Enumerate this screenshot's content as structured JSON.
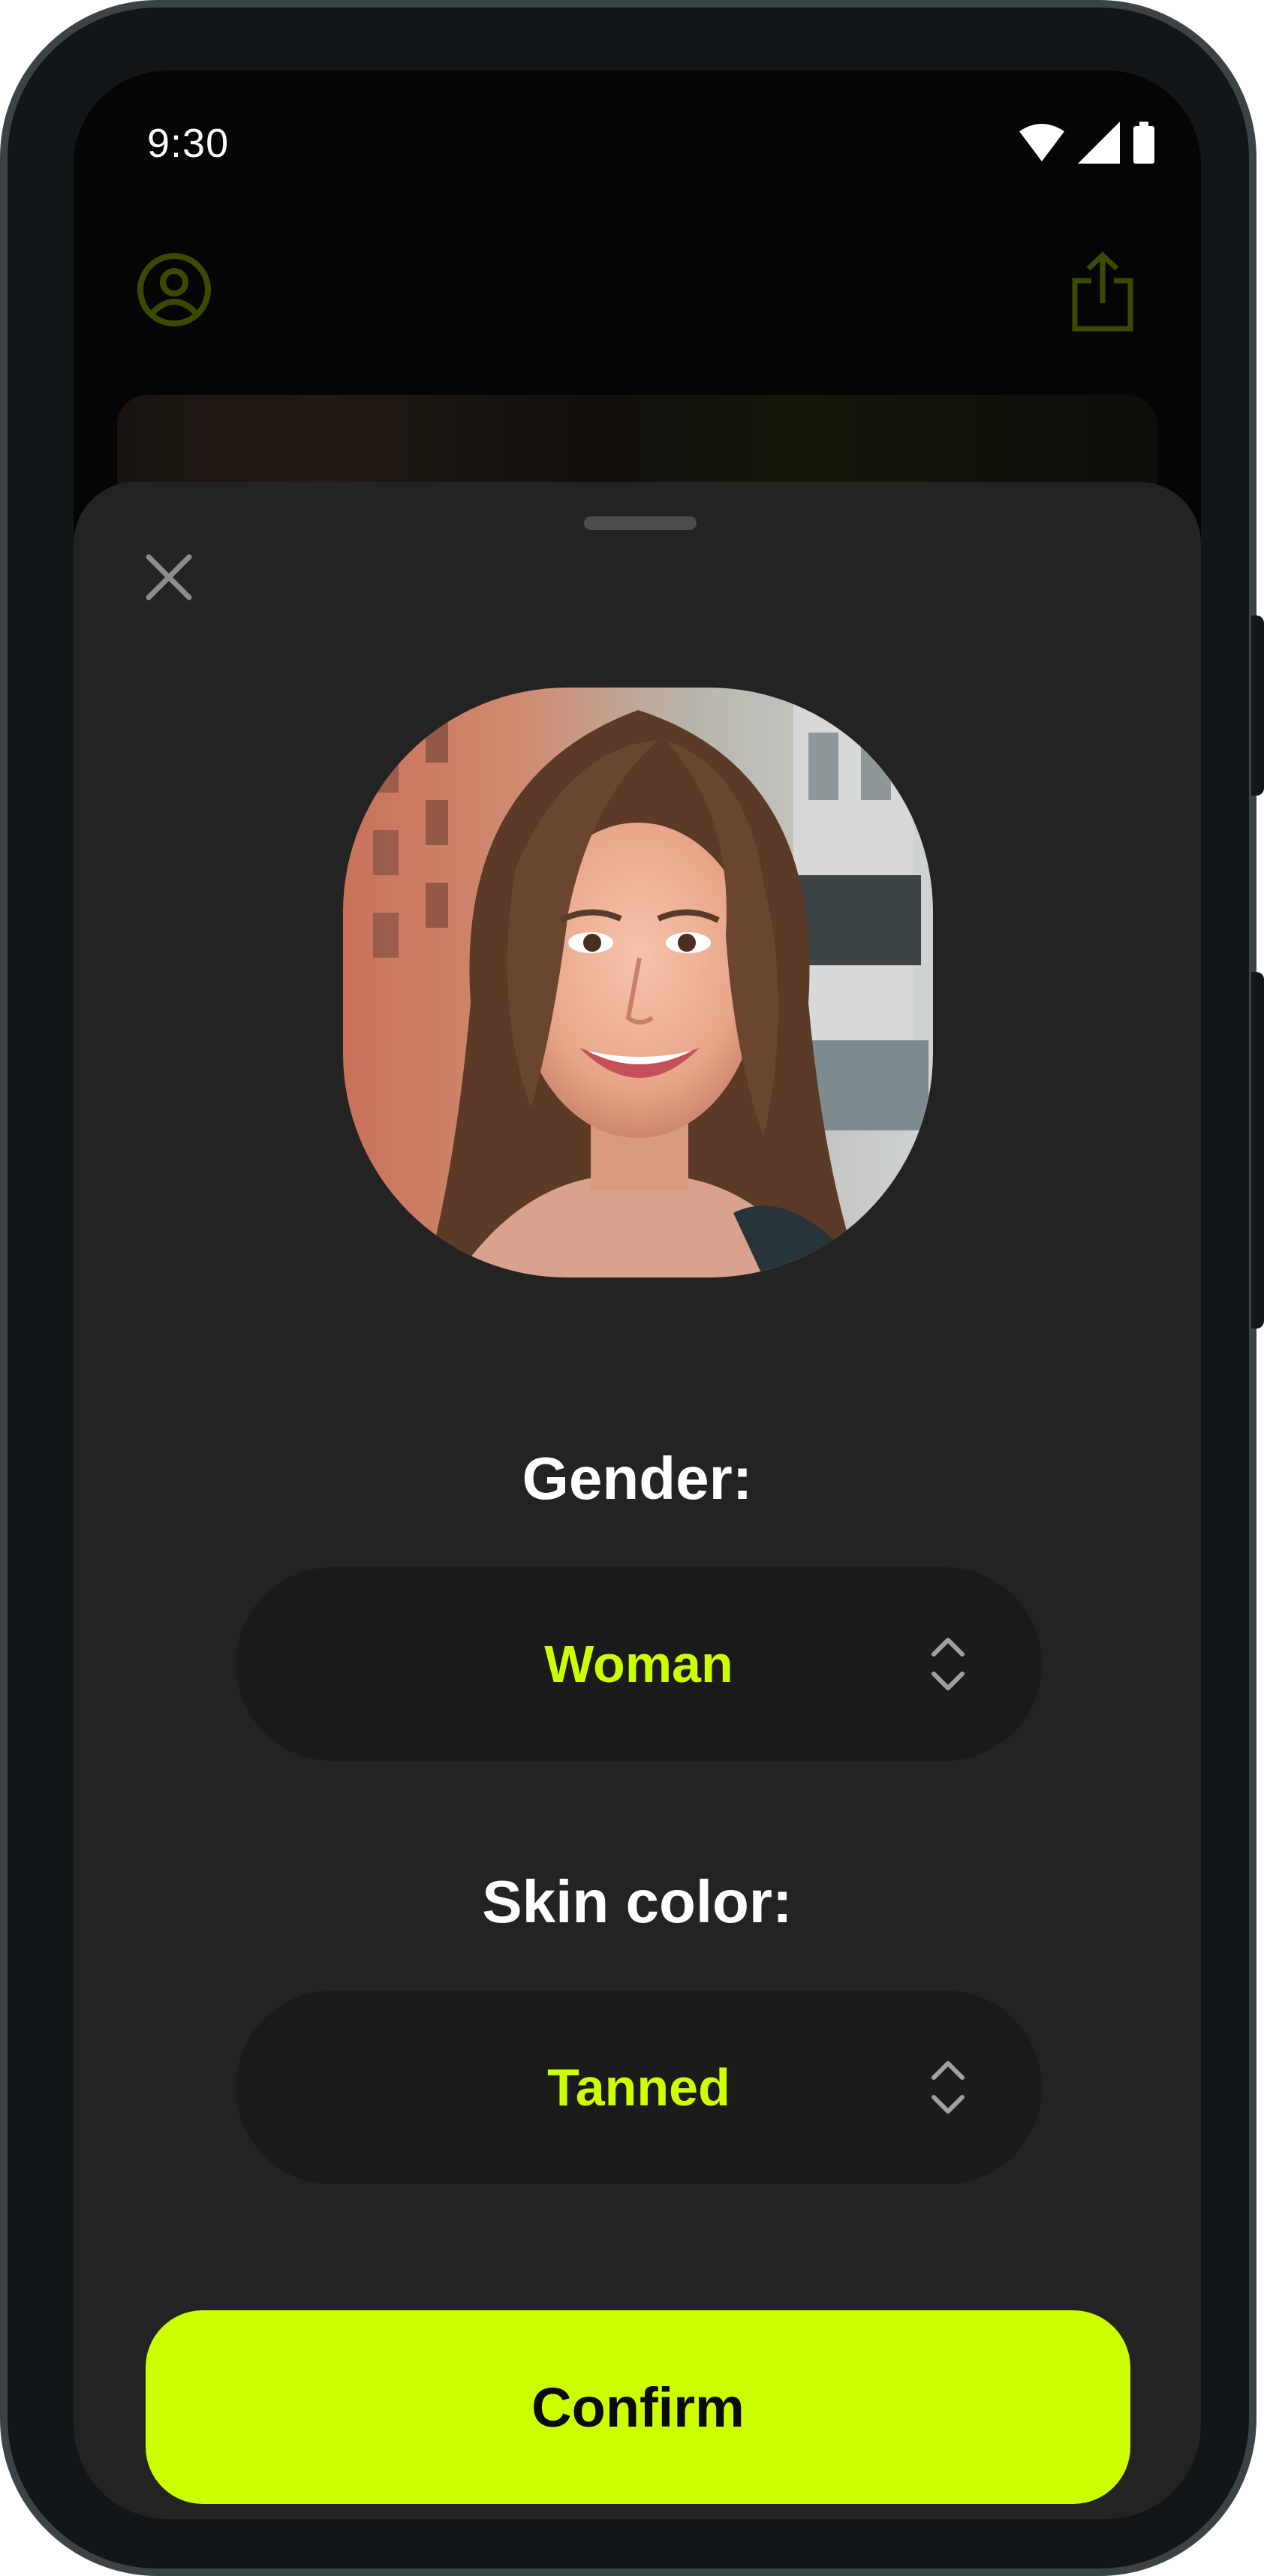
{
  "status_bar": {
    "time": "9:30",
    "icons": [
      "wifi-icon",
      "cellular-signal-icon",
      "battery-icon"
    ]
  },
  "background_app": {
    "header_left_icon": "user-profile-icon",
    "header_right_icon": "share-icon"
  },
  "sheet": {
    "close_icon": "close-icon",
    "photo": "face photo of a smiling woman with long brown hair on a city street",
    "gender": {
      "label": "Gender:",
      "value": "Woman",
      "icon": "chevron-up-down-icon"
    },
    "skin_color": {
      "label": "Skin color:",
      "value": "Tanned",
      "icon": "chevron-up-down-icon"
    },
    "confirm_label": "Confirm"
  },
  "colors": {
    "accent": "#ccff00",
    "sheet_background": "#232323",
    "select_background": "#1b1b1b",
    "dimmed_accent": "#3a4a00"
  }
}
